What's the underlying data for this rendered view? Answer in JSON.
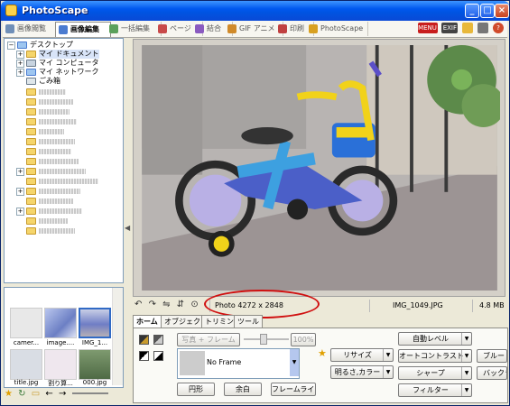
{
  "window": {
    "title": "PhotoScape"
  },
  "tabs": [
    {
      "label": "画像閲覧",
      "icon": "viewer-icon",
      "color": "#6f8fb8"
    },
    {
      "label": "画像編集",
      "icon": "editor-icon",
      "color": "#4a7bd0"
    },
    {
      "label": "一括編集",
      "icon": "batch-icon",
      "color": "#5aa05a"
    },
    {
      "label": "ページ",
      "icon": "page-icon",
      "color": "#c84a4a"
    },
    {
      "label": "結合",
      "icon": "combine-icon",
      "color": "#8a5ac0"
    },
    {
      "label": "GIF アニメ",
      "icon": "gif-icon",
      "color": "#d08a2a"
    },
    {
      "label": "印刷",
      "icon": "print-icon",
      "color": "#c04040"
    },
    {
      "label": "PhotoScape",
      "icon": "photoscape-icon",
      "color": "#d8a020"
    }
  ],
  "top_icons": {
    "menu": "MENU",
    "exif": "EXIF"
  },
  "tree": {
    "root": "デスクトップ",
    "items": [
      "マイ ドキュメント",
      "マイ コンピュータ",
      "マイ ネットワーク",
      "ごみ箱"
    ]
  },
  "thumbnails": [
    {
      "name": "camer...",
      "color": "#e8e8e8"
    },
    {
      "name": "image....",
      "color": "#8ea0d8"
    },
    {
      "name": "IMG_1...",
      "color": "#7a8ac8"
    },
    {
      "name": "title.jpg",
      "color": "#d9dde4"
    },
    {
      "name": "割り算...",
      "color": "#efe7ee"
    },
    {
      "name": "000.jpg",
      "color": "#5d7a55"
    }
  ],
  "status": {
    "photo_size": "Photo 4272 x 2848",
    "filename": "IMG_1049.JPG",
    "filesize": "4.8 MB"
  },
  "edit_tabs": [
    "ホーム",
    "オブジェクト",
    "トリミング",
    "ツール"
  ],
  "home": {
    "frame_label": "写真 + フレーム",
    "zoom": "100%",
    "frame_select": "No Frame",
    "shape_buttons": [
      "円形",
      "余白",
      "フレームライン"
    ],
    "tools": [
      {
        "label": "リサイズ",
        "dropdown": true
      },
      {
        "label": "明るさ,カラー",
        "dropdown": true
      },
      {
        "label": "自動レベル",
        "dropdown": true
      },
      {
        "label": "オートコントラスト",
        "dropdown": true
      },
      {
        "label": "シャープ",
        "dropdown": true
      },
      {
        "label": "フィルター",
        "dropdown": true
      },
      {
        "label": "ブルー",
        "dropdown": false
      },
      {
        "label": "バックラ",
        "dropdown": false
      }
    ]
  },
  "colors": {
    "title_blue": "#0058ee",
    "annotation_red": "#d01010",
    "canvas_bg": "#d4d0c8"
  }
}
